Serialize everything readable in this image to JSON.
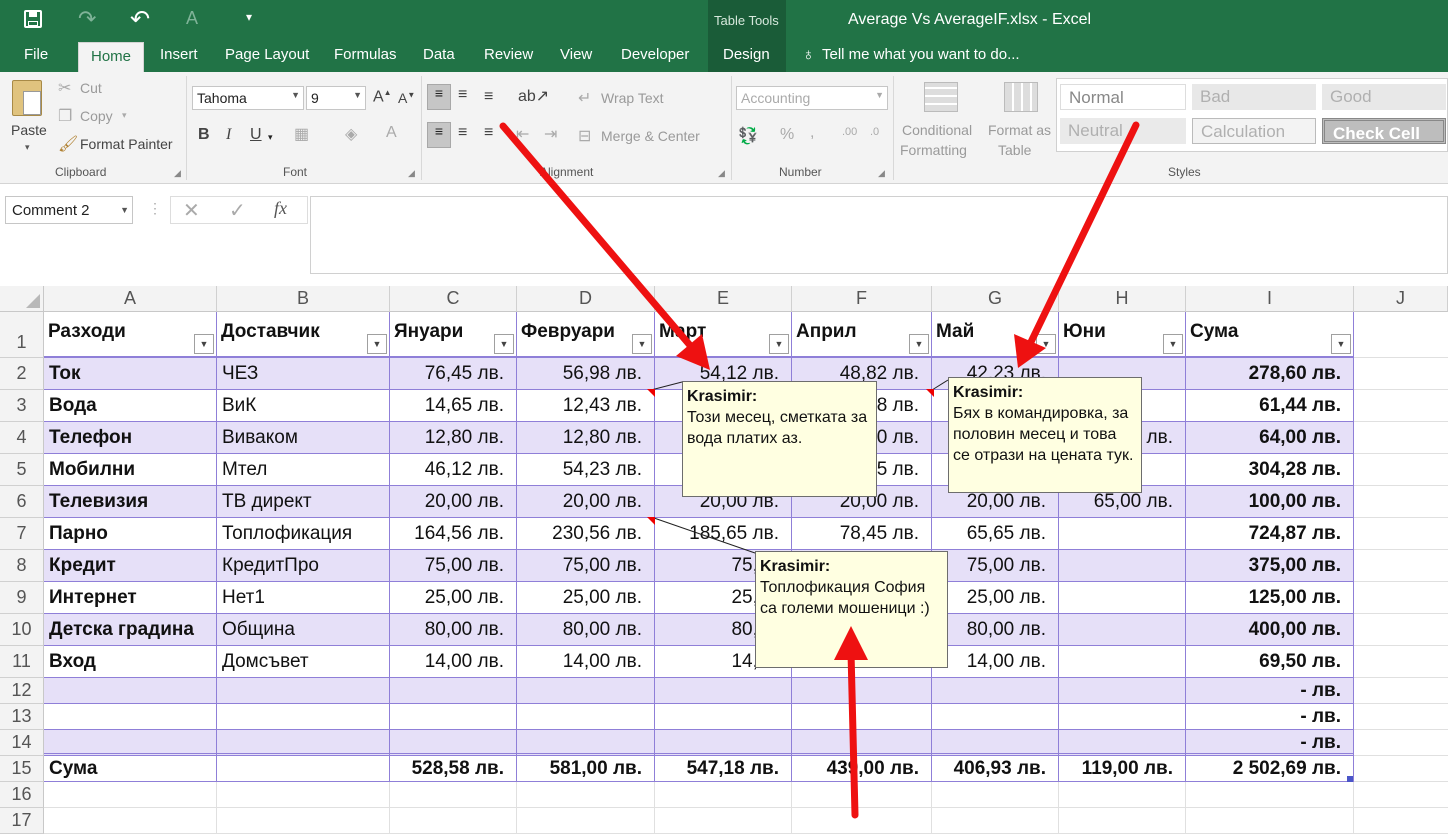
{
  "title_bar": {
    "title": "Average Vs AverageIF.xlsx - Excel",
    "context_group": "Table Tools"
  },
  "tabs": [
    "File",
    "Home",
    "Insert",
    "Page Layout",
    "Formulas",
    "Data",
    "Review",
    "View",
    "Developer",
    "Design"
  ],
  "tell_me": "Tell me what you want to do...",
  "ribbon": {
    "clipboard": {
      "paste": "Paste",
      "cut": "Cut",
      "copy": "Copy",
      "format_painter": "Format Painter",
      "label": "Clipboard"
    },
    "font": {
      "name": "Tahoma",
      "size": "9",
      "label": "Font"
    },
    "alignment": {
      "wrap_text": "Wrap Text",
      "merge_center": "Merge & Center",
      "label": "Alignment"
    },
    "number": {
      "format": "Accounting",
      "label": "Number"
    },
    "styles": {
      "conditional_1": "Conditional",
      "conditional_2": "Formatting",
      "format_table_1": "Format as",
      "format_table_2": "Table",
      "normal": "Normal",
      "bad": "Bad",
      "good": "Good",
      "neutral": "Neutral",
      "calculation": "Calculation",
      "check_cell": "Check Cell",
      "label": "Styles"
    }
  },
  "formula_bar": {
    "name_box": "Comment 2",
    "fx": "fx"
  },
  "columns": [
    "A",
    "B",
    "C",
    "D",
    "E",
    "F",
    "G",
    "H",
    "I",
    "J"
  ],
  "rows": [
    [
      "Разходи",
      "Доставчик",
      "Януари",
      "Февруари",
      "Март",
      "Април",
      "Май",
      "Юни",
      "Сума"
    ],
    [
      "Ток",
      "ЧЕЗ",
      "76,45 лв.",
      "56,98 лв.",
      "54,12 лв.",
      "48,82 лв.",
      "42,23 лв.",
      "",
      "278,60 лв."
    ],
    [
      "Вода",
      "ВиК",
      "14,65 лв.",
      "12,43 лв.",
      "",
      "8 лв.",
      "",
      "",
      "61,44 лв."
    ],
    [
      "Телефон",
      "Виваком",
      "12,80 лв.",
      "12,80 лв.",
      "",
      "0 лв.",
      "",
      "лв.",
      "64,00 лв."
    ],
    [
      "Мобилни",
      "Мтел",
      "46,12 лв.",
      "54,23 лв.",
      "",
      "5 лв.",
      "",
      "",
      "304,28 лв."
    ],
    [
      "Телевизия",
      "ТВ директ",
      "20,00 лв.",
      "20,00 лв.",
      "20,00 лв.",
      "20,00 лв.",
      "20,00 лв.",
      "65,00 лв.",
      "100,00 лв."
    ],
    [
      "Парно",
      "Топлофикация",
      "164,56 лв.",
      "230,56 лв.",
      "185,65 лв.",
      "78,45 лв.",
      "65,65 лв.",
      "",
      "724,87 лв."
    ],
    [
      "Кредит",
      "КредитПро",
      "75,00 лв.",
      "75,00 лв.",
      "75,00",
      "",
      "75,00 лв.",
      "",
      "375,00 лв."
    ],
    [
      "Интернет",
      "Нет1",
      "25,00 лв.",
      "25,00 лв.",
      "25,00",
      "",
      "25,00 лв.",
      "",
      "125,00 лв."
    ],
    [
      "Детска градина",
      "Община",
      "80,00 лв.",
      "80,00 лв.",
      "80,00",
      "",
      "80,00 лв.",
      "",
      "400,00 лв."
    ],
    [
      "Вход",
      "Домсъвет",
      "14,00 лв.",
      "14,00 лв.",
      "14,00",
      "",
      "14,00 лв.",
      "",
      "69,50 лв."
    ],
    [
      "",
      "",
      "",
      "",
      "",
      "",
      "",
      "",
      "-     лв."
    ],
    [
      "",
      "",
      "",
      "",
      "",
      "",
      "",
      "",
      "-     лв."
    ],
    [
      "",
      "",
      "",
      "",
      "",
      "",
      "",
      "",
      "-     лв."
    ],
    [
      "Сума",
      "",
      "528,58 лв.",
      "581,00 лв.",
      "547,18 лв.",
      "439,00 лв.",
      "406,93 лв.",
      "119,00 лв.",
      "2 502,69 лв."
    ],
    [
      "",
      "",
      "",
      "",
      "",
      "",
      "",
      "",
      ""
    ],
    [
      "",
      "",
      "",
      "",
      "",
      "",
      "",
      "",
      ""
    ]
  ],
  "comments": [
    {
      "author": "Krasimir:",
      "text": "Този месец, сметката за вода платих аз."
    },
    {
      "author": "Krasimir:",
      "text": "Бях в командировка, за половин месец и това се отрази на цената тук."
    },
    {
      "author": "Krasimir:",
      "text": "Топлофикация София са големи мошеници :)"
    }
  ],
  "colors": {
    "excel_green": "#217346",
    "band": "#e6e0f8",
    "arrow": "#ee1111",
    "comment_bg": "#ffffe1"
  }
}
